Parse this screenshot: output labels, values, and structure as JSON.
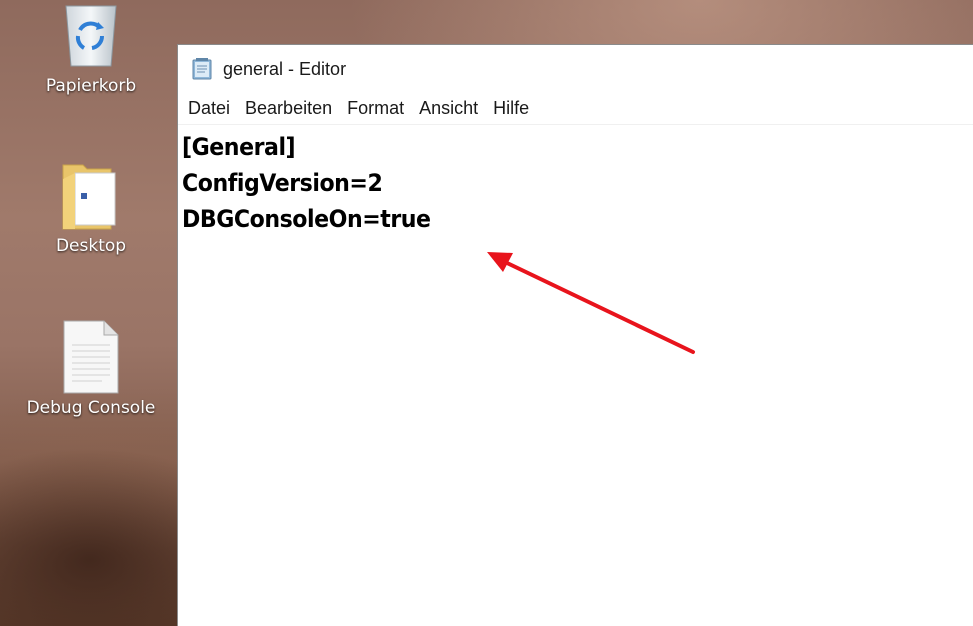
{
  "desktop": {
    "icons": [
      {
        "label": "Papierkorb",
        "icon": "recycle-bin-icon"
      },
      {
        "label": "Desktop",
        "icon": "folder-icon"
      },
      {
        "label": "Debug Console",
        "icon": "text-file-icon"
      }
    ]
  },
  "window": {
    "title": "general - Editor",
    "icon": "notepad-icon",
    "menu": [
      "Datei",
      "Bearbeiten",
      "Format",
      "Ansicht",
      "Hilfe"
    ],
    "content_lines": [
      "[General]",
      "ConfigVersion=2",
      "DBGConsoleOn=true"
    ]
  },
  "annotation": {
    "arrow_color": "#e8141c"
  }
}
